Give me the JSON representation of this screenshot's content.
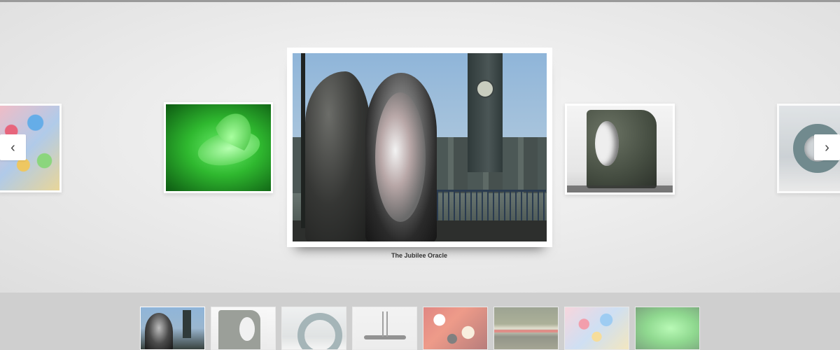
{
  "gallery": {
    "current_caption": "The Jubilee Oracle",
    "prev_label": "‹",
    "next_label": "›"
  },
  "slides": [
    {
      "id": "abstract",
      "icon": "abstract-painting"
    },
    {
      "id": "dove",
      "icon": "green-dove-hologram"
    },
    {
      "id": "jubilee",
      "icon": "jubilee-oracle-sculpture"
    },
    {
      "id": "stone",
      "icon": "stone-ring-sculpture"
    },
    {
      "id": "ring",
      "icon": "bronze-ring-sculpture"
    }
  ],
  "thumbnails": [
    {
      "id": "jubilee",
      "active": true
    },
    {
      "id": "stone",
      "active": false
    },
    {
      "id": "ring",
      "active": false
    },
    {
      "id": "spindle",
      "active": false
    },
    {
      "id": "red-abstract",
      "active": false
    },
    {
      "id": "landscape",
      "active": false
    },
    {
      "id": "abstract",
      "active": false
    },
    {
      "id": "dove",
      "active": false
    }
  ],
  "colors": {
    "background": "#e9e9e9",
    "strip": "#cfcfcf",
    "button": "#ffffff",
    "caption_text": "#333333"
  }
}
